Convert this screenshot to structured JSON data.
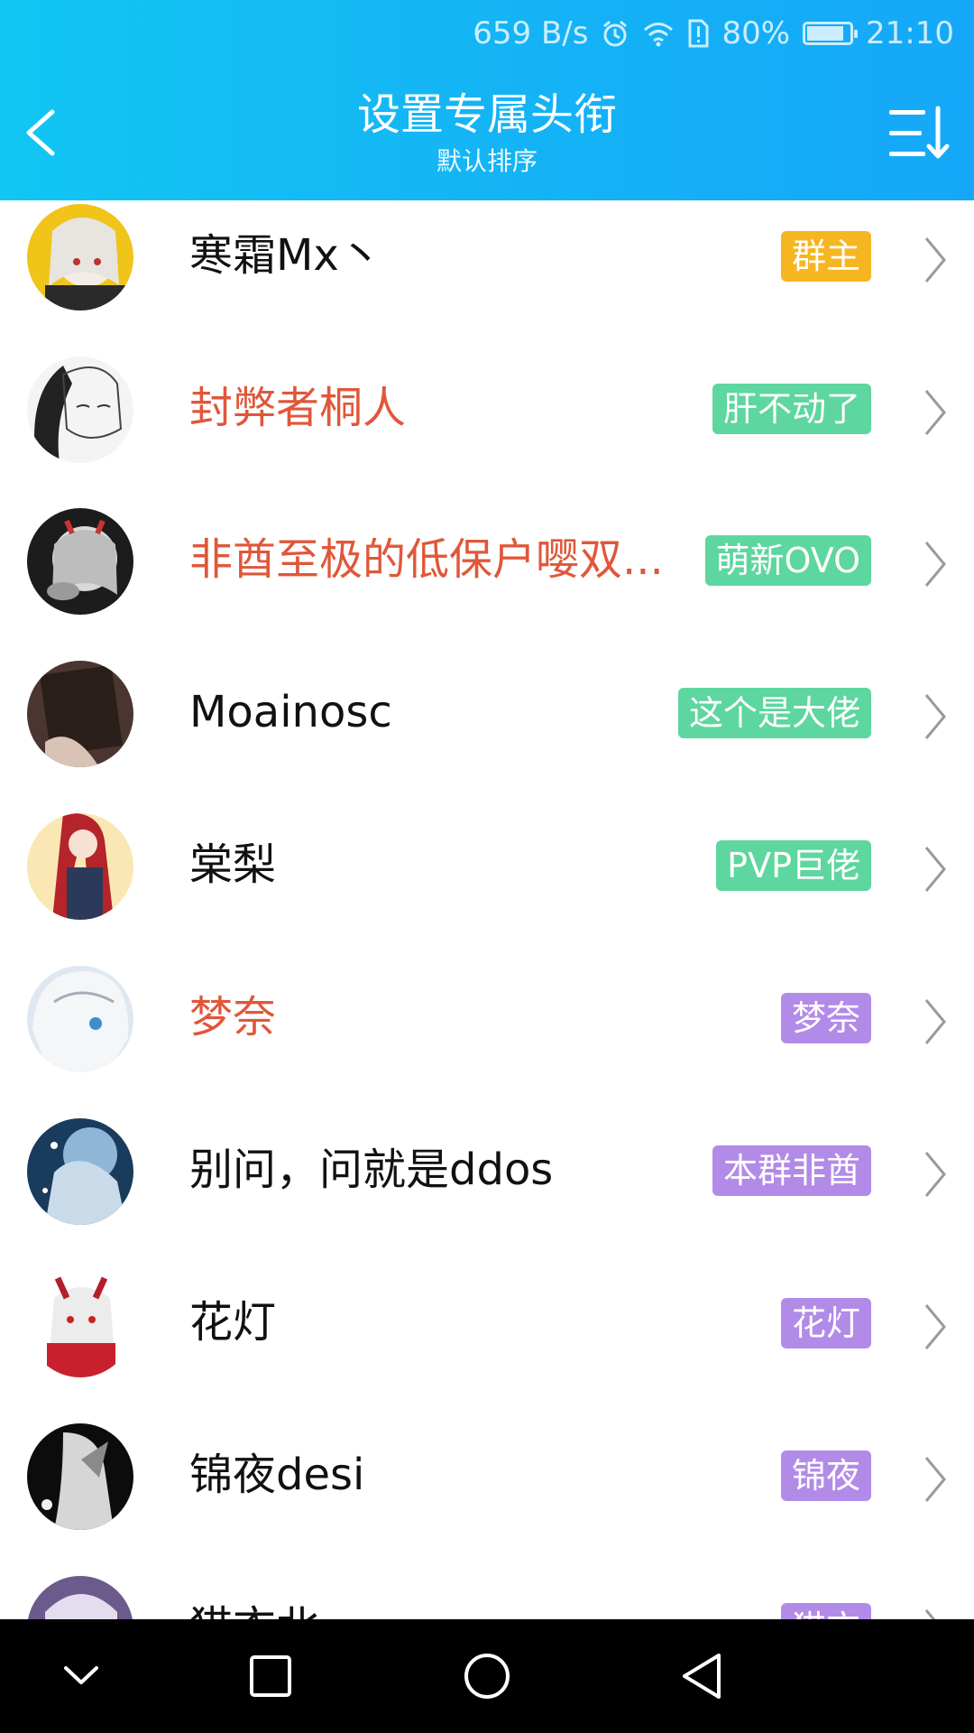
{
  "status_bar": {
    "speed": "659 B/s",
    "battery": "80%",
    "battery_level": 0.8,
    "time": "21:10"
  },
  "header": {
    "title": "设置专属头衔",
    "subtitle": "默认排序"
  },
  "colors": {
    "header_start": "#12c6f3",
    "header_end": "#15a8f8",
    "owner_badge": "#f5b622",
    "green_badge": "#5ed69f",
    "purple_badge": "#b28be8",
    "highlight_name": "#e0573a"
  },
  "members": [
    {
      "name": "寒霜Mx丶",
      "title": "群主",
      "badge_color": "#f5b622",
      "highlight": false
    },
    {
      "name": "封弊者桐人",
      "title": "肝不动了",
      "badge_color": "#5ed69f",
      "highlight": true
    },
    {
      "name": "非酋至极的低保户嘤双...",
      "title": "萌新OVO",
      "badge_color": "#5ed69f",
      "highlight": true
    },
    {
      "name": "Moainosc",
      "title": "这个是大佬",
      "badge_color": "#5ed69f",
      "highlight": false
    },
    {
      "name": "棠梨",
      "title": "PVP巨佬",
      "badge_color": "#5ed69f",
      "highlight": false
    },
    {
      "name": "梦奈",
      "title": "梦奈",
      "badge_color": "#b28be8",
      "highlight": true
    },
    {
      "name": "别问，问就是ddos",
      "title": "本群非酋",
      "badge_color": "#b28be8",
      "highlight": false
    },
    {
      "name": "花灯",
      "title": "花灯",
      "badge_color": "#b28be8",
      "highlight": false
    },
    {
      "name": "锦夜desi",
      "title": "锦夜",
      "badge_color": "#b28be8",
      "highlight": false
    },
    {
      "name": "猫衣北",
      "title": "猫衣",
      "badge_color": "#b28be8",
      "highlight": false
    }
  ],
  "icons": {
    "back": "back-arrow-icon",
    "sort": "sort-icon",
    "chevron": "chevron-right-icon",
    "nav": [
      "nav-down-icon",
      "nav-recents-icon",
      "nav-home-icon",
      "nav-back-icon"
    ]
  }
}
